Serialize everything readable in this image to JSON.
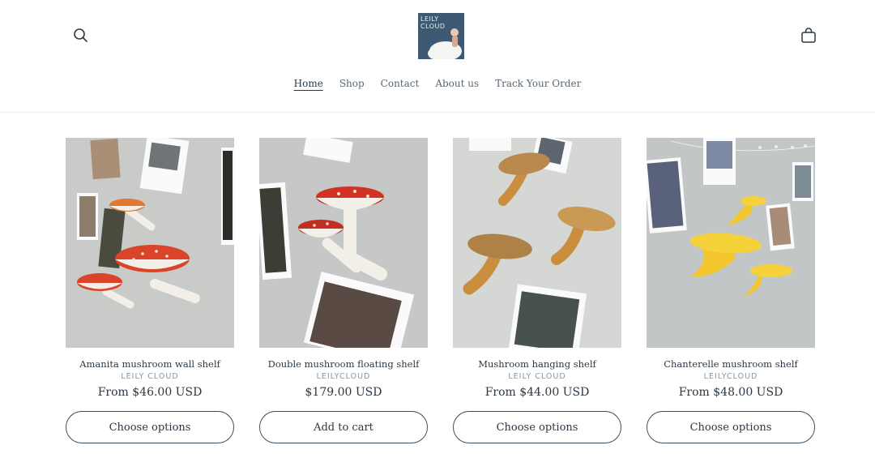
{
  "store": {
    "logo_text": "LEILY\nCLOUD"
  },
  "header": {
    "search_icon": "search-icon",
    "cart_icon": "shopping-bag-icon"
  },
  "nav": [
    {
      "label": "Home",
      "active": true
    },
    {
      "label": "Shop",
      "active": false
    },
    {
      "label": "Contact",
      "active": false
    },
    {
      "label": "About us",
      "active": false
    },
    {
      "label": "Track Your Order",
      "active": false
    }
  ],
  "products": [
    {
      "title": "Amanita mushroom wall shelf",
      "vendor": "LEILY CLOUD",
      "price": "From $46.00 USD",
      "button": "Choose options"
    },
    {
      "title": "Double mushroom floating shelf",
      "vendor": "LEILYCLOUD",
      "price": "$179.00 USD",
      "button": "Add to cart"
    },
    {
      "title": "Mushroom hanging shelf",
      "vendor": "LEILY CLOUD",
      "price": "From $44.00 USD",
      "button": "Choose options"
    },
    {
      "title": "Chanterelle mushroom shelf",
      "vendor": "LEILYCLOUD",
      "price": "From $48.00 USD",
      "button": "Choose options"
    }
  ],
  "colors": {
    "wall": "#c9ccc9",
    "amanita_red": "#d9442b",
    "stem_white": "#f1efe8",
    "golden": "#c98f3f",
    "chanterelle_yellow": "#f2c62c",
    "button_border": "#3c4e5d",
    "text": "#2b3844"
  }
}
